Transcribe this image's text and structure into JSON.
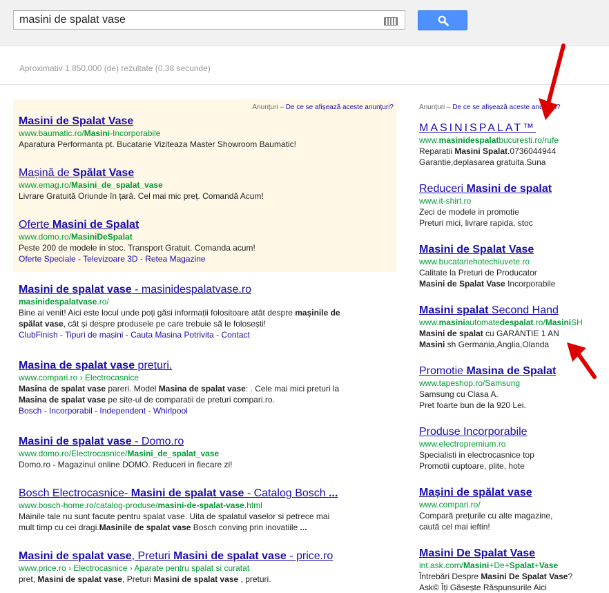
{
  "search": {
    "query": "masini de spalat vase",
    "button_label": "Search"
  },
  "stats": "Aproximativ 1.850.000 (de) rezultate (0,38 secunde)",
  "ads_label": {
    "prefix": "Anunțuri",
    "dash": " – ",
    "link": "De ce se afișează aceste anunțuri?"
  },
  "top_ads": [
    {
      "title_parts": [
        {
          "text": "Masini de Spalat Vase",
          "b": true
        }
      ],
      "url_parts": [
        {
          "text": "www.baumatic.ro/",
          "b": false
        },
        {
          "text": "Masini",
          "b": true
        },
        {
          "text": "-Incorporabile",
          "b": false
        }
      ],
      "snippet": "Aparatura Performanta pt. Bucatarie Viziteaza Master Showroom Baumatic!"
    },
    {
      "title_parts": [
        {
          "text": "Mașină de ",
          "b": false
        },
        {
          "text": "Spălat Vase",
          "b": true
        }
      ],
      "url_parts": [
        {
          "text": "www.emag.ro/",
          "b": false
        },
        {
          "text": "Masini_de_spalat_vase",
          "b": true
        }
      ],
      "snippet": "Livrare Gratuită Oriunde în țară. Cel mai mic preț. Comandă Acum!"
    },
    {
      "title_parts": [
        {
          "text": "Oferte ",
          "b": false
        },
        {
          "text": "Masini de Spalat",
          "b": true
        }
      ],
      "url_parts": [
        {
          "text": "www.domo.ro/",
          "b": false
        },
        {
          "text": "MasiniDeSpalat",
          "b": true
        }
      ],
      "snippet": "Peste 200 de modele in stoc. Transport Gratuit. Comanda acum!",
      "links": [
        "Oferte Speciale",
        "Televizoare 3D",
        "Retea Magazine"
      ]
    }
  ],
  "organic": [
    {
      "title_parts": [
        {
          "text": "Masini de spalat vase",
          "b": true
        },
        {
          "text": " - masinidespalatvase.ro",
          "b": false
        }
      ],
      "url_parts": [
        {
          "text": "masinidespalatvase",
          "b": true
        },
        {
          "text": ".ro/",
          "b": false
        }
      ],
      "snippet_lines": [
        [
          {
            "text": "Bine ai venit! Aici este locul unde poți găsi informații folositoare atât despre ",
            "b": false
          },
          {
            "text": "mașinile de",
            "b": true
          }
        ],
        [
          {
            "text": "spălat vase",
            "b": true
          },
          {
            "text": ", cât și despre produsele pe care trebuie să le folosești!",
            "b": false
          }
        ]
      ],
      "links": [
        "ClubFinish",
        "Tipuri de mașini",
        "Cauta Masina Potrivita",
        "Contact"
      ]
    },
    {
      "title_parts": [
        {
          "text": "Masina de spalat vase",
          "b": true
        },
        {
          "text": " preturi.",
          "b": false
        }
      ],
      "url_parts": [
        {
          "text": "www.compari.ro › Electrocasnice",
          "b": false
        }
      ],
      "snippet_lines": [
        [
          {
            "text": "Masina de spalat vase",
            "b": true
          },
          {
            "text": " pareri. Model ",
            "b": false
          },
          {
            "text": "Masina de spalat vase",
            "b": true
          },
          {
            "text": ": . Cele mai mici preturi la",
            "b": false
          }
        ],
        [
          {
            "text": "Masina de spalat vase",
            "b": true
          },
          {
            "text": " pe site-ul de comparatii de preturi compari.ro.",
            "b": false
          }
        ]
      ],
      "links": [
        "Bosch",
        "Incorporabil",
        "Independent",
        "Whirlpool"
      ]
    },
    {
      "title_parts": [
        {
          "text": "Masini de spalat vase",
          "b": true
        },
        {
          "text": " - Domo.ro",
          "b": false
        }
      ],
      "url_parts": [
        {
          "text": "www.domo.ro/Electrocasnice/",
          "b": false
        },
        {
          "text": "Masini_de_spalat_vase",
          "b": true
        }
      ],
      "snippet_lines": [
        [
          {
            "text": "Domo.ro - Magazinul online DOMO. Reduceri in fiecare zi!",
            "b": false
          }
        ]
      ]
    },
    {
      "title_parts": [
        {
          "text": "Bosch Electrocasnice- ",
          "b": false
        },
        {
          "text": "Masini de spalat vase",
          "b": true
        },
        {
          "text": " - Catalog Bosch ",
          "b": false
        },
        {
          "text": "...",
          "b": true
        }
      ],
      "url_parts": [
        {
          "text": "www.bosch-home.ro/catalog-produse/",
          "b": false
        },
        {
          "text": "masini-de-spalat-vase",
          "b": true
        },
        {
          "text": ".html",
          "b": false
        }
      ],
      "snippet_lines": [
        [
          {
            "text": "Mainile tale nu sunt facute pentru spalat vase. Uita de spalatul vaselor si petrece mai",
            "b": false
          }
        ],
        [
          {
            "text": "mult timp cu cei dragi.",
            "b": false
          },
          {
            "text": "Masinile de spalat vase",
            "b": true
          },
          {
            "text": " Bosch conving prin inovatiile ",
            "b": false
          },
          {
            "text": "...",
            "b": true
          }
        ]
      ]
    },
    {
      "title_parts": [
        {
          "text": "Masini de spalat vase",
          "b": true
        },
        {
          "text": ", Preturi ",
          "b": false
        },
        {
          "text": "Masini de spalat vase",
          "b": true
        },
        {
          "text": " - price.ro",
          "b": false
        }
      ],
      "url_parts": [
        {
          "text": "www.price.ro › Electrocasnice › Aparate pentru spalat si curatat",
          "b": false
        }
      ],
      "snippet_lines": [
        [
          {
            "text": "pret, ",
            "b": false
          },
          {
            "text": "Masini de spalat vase",
            "b": true
          },
          {
            "text": ", Preturi ",
            "b": false
          },
          {
            "text": "Masini de spalat vase",
            "b": true
          },
          {
            "text": " , preturi.",
            "b": false
          }
        ]
      ]
    }
  ],
  "right_ads": [
    {
      "title_parts": [
        {
          "text": "MASINISPALAT™",
          "b": false
        }
      ],
      "spaced": true,
      "url_parts": [
        {
          "text": "www.",
          "b": false
        },
        {
          "text": "masinidespalat",
          "b": true
        },
        {
          "text": "bucuresti.ro/rufe",
          "b": false
        }
      ],
      "snippet_lines": [
        [
          {
            "text": "Reparatii ",
            "b": false
          },
          {
            "text": "Masini Spalat",
            "b": true
          },
          {
            "text": ".0736044944",
            "b": false
          }
        ],
        [
          {
            "text": "Garantie,deplasarea gratuita.Suna",
            "b": false
          }
        ]
      ]
    },
    {
      "title_parts": [
        {
          "text": "Reduceri ",
          "b": false
        },
        {
          "text": "Masini de spalat",
          "b": true
        }
      ],
      "url_parts": [
        {
          "text": "www.it-shirt.ro",
          "b": false
        }
      ],
      "snippet_lines": [
        [
          {
            "text": "Zeci de modele in promotie",
            "b": false
          }
        ],
        [
          {
            "text": "Preturi mici, livrare rapida, stoc",
            "b": false
          }
        ]
      ]
    },
    {
      "title_parts": [
        {
          "text": "Masini de Spalat Vase",
          "b": true
        }
      ],
      "url_parts": [
        {
          "text": "www.bucatariehotechiuvete.ro",
          "b": false
        }
      ],
      "snippet_lines": [
        [
          {
            "text": "Calitate la Preturi de Producator",
            "b": false
          }
        ],
        [
          {
            "text": "Masini de Spalat Vase",
            "b": true
          },
          {
            "text": " Incorporabile",
            "b": false
          }
        ]
      ]
    },
    {
      "title_parts": [
        {
          "text": "Masini spalat",
          "b": true
        },
        {
          "text": " Second Hand",
          "b": false
        }
      ],
      "url_parts": [
        {
          "text": "www.",
          "b": false
        },
        {
          "text": "masini",
          "b": true
        },
        {
          "text": "automate",
          "b": false
        },
        {
          "text": "despalat",
          "b": true
        },
        {
          "text": ".ro/",
          "b": false
        },
        {
          "text": "Masini",
          "b": true
        },
        {
          "text": "SH",
          "b": false
        }
      ],
      "snippet_lines": [
        [
          {
            "text": "Masini de spalat",
            "b": true
          },
          {
            "text": " cu GARANTIE 1 AN",
            "b": false
          }
        ],
        [
          {
            "text": "Masini",
            "b": true
          },
          {
            "text": " sh Germania,Anglia,Olanda",
            "b": false
          }
        ]
      ]
    },
    {
      "title_parts": [
        {
          "text": "Promotie ",
          "b": false
        },
        {
          "text": "Masina de Spalat",
          "b": true
        }
      ],
      "url_parts": [
        {
          "text": "www.tapeshop.ro/Samsung",
          "b": false
        }
      ],
      "snippet_lines": [
        [
          {
            "text": "Samsung cu Clasa A.",
            "b": false
          }
        ],
        [
          {
            "text": "Pret foarte bun de la 920 Lei.",
            "b": false
          }
        ]
      ]
    },
    {
      "title_parts": [
        {
          "text": "Produse Incorporabile",
          "b": false
        }
      ],
      "url_parts": [
        {
          "text": "www.electropremium.ro",
          "b": false
        }
      ],
      "snippet_lines": [
        [
          {
            "text": "Specialisti in electrocasnice top",
            "b": false
          }
        ],
        [
          {
            "text": "Promotii cuptoare, plite, hote",
            "b": false
          }
        ]
      ]
    },
    {
      "title_parts": [
        {
          "text": "Mașini de spălat vase",
          "b": true
        }
      ],
      "url_parts": [
        {
          "text": "www.compari.ro/",
          "b": false
        }
      ],
      "snippet_lines": [
        [
          {
            "text": "Compară prețurile cu alte magazine,",
            "b": false
          }
        ],
        [
          {
            "text": "caută cel mai ieftin!",
            "b": false
          }
        ]
      ]
    },
    {
      "title_parts": [
        {
          "text": "Masini De Spalat Vase",
          "b": true
        }
      ],
      "url_parts": [
        {
          "text": "int.ask.com/",
          "b": false
        },
        {
          "text": "Masini",
          "b": true
        },
        {
          "text": "+De+",
          "b": false
        },
        {
          "text": "Spalat",
          "b": true
        },
        {
          "text": "+",
          "b": false
        },
        {
          "text": "Vase",
          "b": true
        }
      ],
      "snippet_lines": [
        [
          {
            "text": "Întrebări Despre ",
            "b": false
          },
          {
            "text": "Masini De Spalat Vase",
            "b": true
          },
          {
            "text": "?",
            "b": false
          }
        ],
        [
          {
            "text": "Ask© Îți Găsește Răspunsurile Aici",
            "b": false
          }
        ]
      ]
    }
  ],
  "colors": {
    "link": "#1a0dab",
    "url": "#009933",
    "ad_background": "#fff8e7",
    "arrow": "#dd0000",
    "button": "#4d90fe"
  }
}
